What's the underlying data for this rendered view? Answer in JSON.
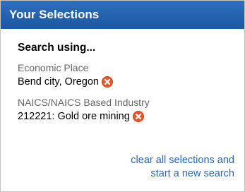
{
  "panel": {
    "title": "Your Selections",
    "search_heading": "Search using..."
  },
  "selections": [
    {
      "label": "Economic Place",
      "value": "Bend city, Oregon",
      "remove_icon": "remove-icon"
    },
    {
      "label": "NAICS/NAICS Based Industry",
      "value": "212221: Gold ore mining",
      "remove_icon": "remove-icon"
    }
  ],
  "clear_link": {
    "line1": "clear all selections and",
    "line2": "start a new search"
  },
  "colors": {
    "header_bg": "#1b57a3",
    "link": "#2a67b8",
    "remove_icon": "#e8572a"
  }
}
